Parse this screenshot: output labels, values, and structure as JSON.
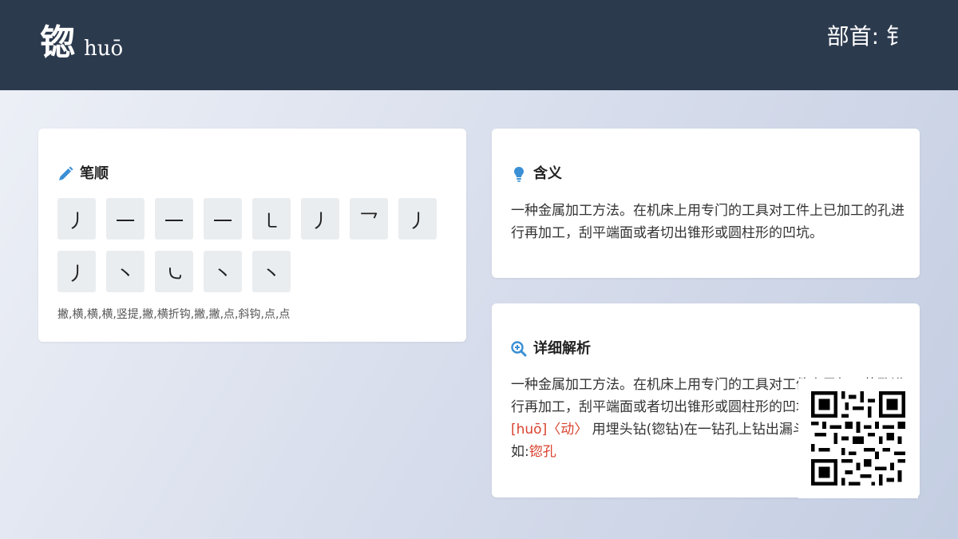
{
  "header": {
    "character": "锪",
    "pinyin": "huō",
    "radical": "部首: 钅"
  },
  "stroke_order": {
    "title": "笔顺",
    "strokes": [
      "丿",
      "一",
      "一",
      "一",
      "㇄",
      "丿",
      "乛",
      "丿",
      "丿",
      "丶",
      "㇃",
      "丶",
      "丶"
    ],
    "names": "撇,横,横,横,竖提,撇,横折钩,撇,撇,点,斜钩,点,点"
  },
  "meaning": {
    "title": "含义",
    "text": "一种金属加工方法。在机床上用专门的工具对工件上已加工的孔进行再加工，刮平端面或者切出锥形或圆柱形的凹坑。"
  },
  "detail": {
    "title": "详细解析",
    "text": "一种金属加工方法。在机床上用专门的工具对工件上已加工的孔进行再加工，刮平端面或者切出锥形或圆柱形的凹坑。",
    "pron": "[huō]",
    "pos": "〈动〉",
    "def": " 用埋头钻(锪钻)在一钻孔上钻出漏斗状的凹坑。",
    "example_prefix": "如:",
    "example": "锪孔"
  },
  "colors": {
    "header_bg": "#2c3a4e",
    "accent_blue": "#3b8fd4",
    "accent_red": "#d9432f"
  },
  "icons": {
    "stroke": "pencil-icon",
    "meaning": "lightbulb-icon",
    "detail": "search-plus-icon"
  }
}
